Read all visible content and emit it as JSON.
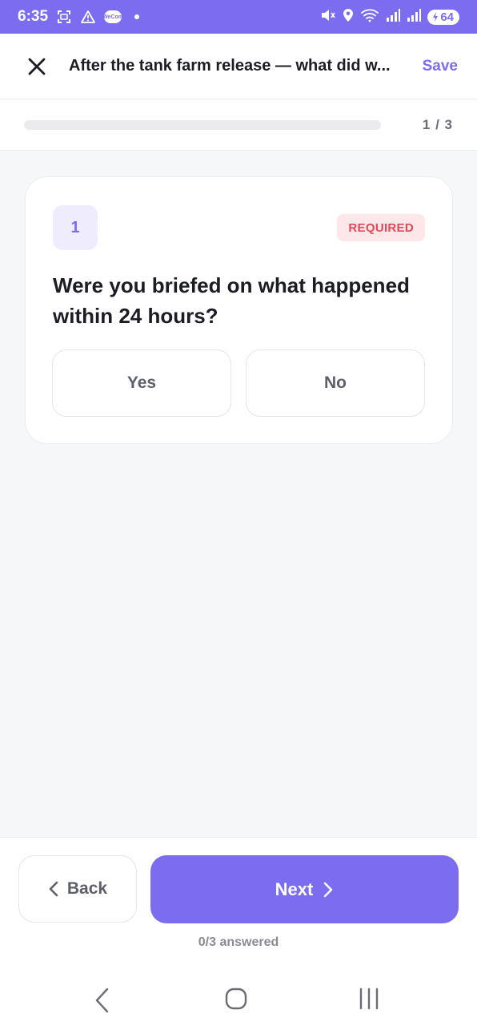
{
  "status_bar": {
    "time": "6:35",
    "battery": "64",
    "left_icons": [
      "screenshot-icon",
      "warning-icon",
      "wecom-icon"
    ],
    "wecom_label": "WeCom",
    "right_icons": [
      "mute-icon",
      "location-icon",
      "wifi-icon",
      "signal-icon",
      "signal-icon"
    ]
  },
  "header": {
    "title": "After the tank farm release — what did w...",
    "save_label": "Save",
    "close_icon": "close-icon"
  },
  "progress": {
    "label": "1 / 3",
    "fraction": 0.0
  },
  "question": {
    "number": "1",
    "required_label": "REQUIRED",
    "text": "Were you briefed on what happened within 24 hours?",
    "options": [
      "Yes",
      "No"
    ]
  },
  "footer": {
    "back_label": "Back",
    "next_label": "Next",
    "answered_label": "0/3 answered"
  },
  "colors": {
    "accent": "#7b6cf0",
    "required_bg": "#fde7e9",
    "required_text": "#e1485a",
    "background": "#f6f7f9"
  }
}
